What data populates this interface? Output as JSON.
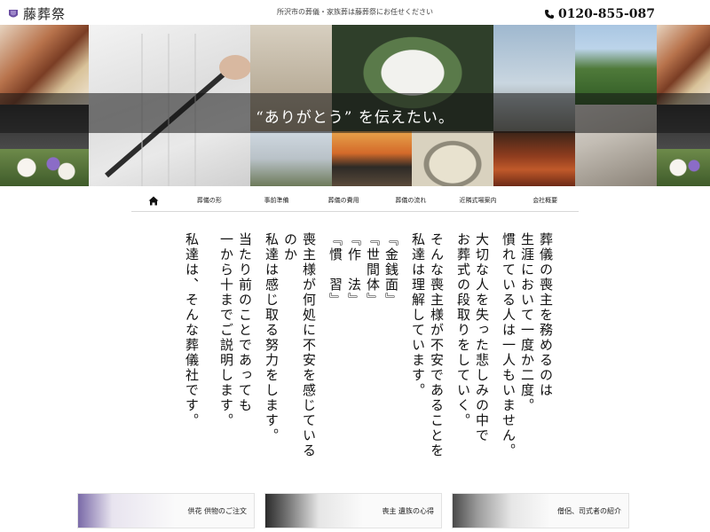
{
  "header": {
    "logo_text": "藤葬祭",
    "tagline": "所沢市の葬儀・家族葬は藤葬祭にお任せください",
    "phone": "0120-855-087"
  },
  "hero": {
    "catch": "“ありがとう” を伝えたい。"
  },
  "nav": {
    "items": [
      "葬儀の形",
      "事前準備",
      "葬儀の費用",
      "葬儀の流れ",
      "近隣式場案内",
      "会社概要"
    ]
  },
  "message": {
    "columns": [
      "葬儀の喪主を務めるのは",
      "生涯において一度か二度。",
      "慣れている人は一人もいません。",
      "",
      "大切な人を失った悲しみの中で",
      "お葬式の段取りをしていく。",
      "",
      "そんな喪主様が不安であることを",
      "私達は理解しています。",
      "",
      "『金銭面』",
      "『世間体』",
      "『作　法』",
      "『慣　習』",
      "",
      "喪主様が何処に不安を感じているのか",
      "私達は感じ取る努力をします。",
      "",
      "当たり前のことであっても",
      "一から十までご説明します。",
      "",
      "私達は、そんな葬儀社です。"
    ]
  },
  "banners": [
    {
      "label": "供花 供物のご注文"
    },
    {
      "label": "喪主 遺族の心得"
    },
    {
      "label": "僧侶、司式者の紹介"
    }
  ],
  "colors": {
    "brand": "#6b4fa3",
    "hero_band": "#202020",
    "text": "#111111"
  }
}
